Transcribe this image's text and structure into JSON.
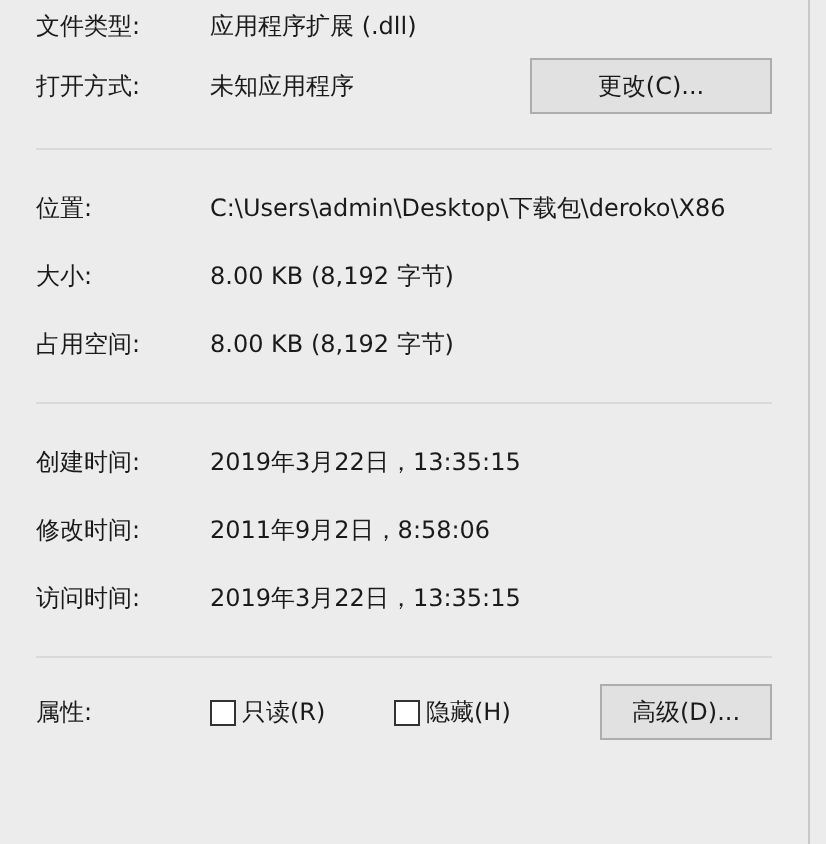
{
  "general": [
    {
      "label": "文件类型:",
      "value": "应用程序扩展 (.dll)"
    },
    {
      "label": "打开方式:",
      "value": "未知应用程序",
      "button": "更改(C)..."
    }
  ],
  "location": [
    {
      "label": "位置:",
      "value": "C:\\Users\\admin\\Desktop\\下载包\\deroko\\X86"
    },
    {
      "label": "大小:",
      "value": "8.00 KB (8,192 字节)"
    },
    {
      "label": "占用空间:",
      "value": "8.00 KB (8,192 字节)"
    }
  ],
  "times": [
    {
      "label": "创建时间:",
      "value": "2019年3月22日，13:35:15"
    },
    {
      "label": "修改时间:",
      "value": "2011年9月2日，8:58:06"
    },
    {
      "label": "访问时间:",
      "value": "2019年3月22日，13:35:15"
    }
  ],
  "attributes": {
    "label": "属性:",
    "checkboxes": [
      {
        "label": "只读(R)",
        "checked": false
      },
      {
        "label": "隐藏(H)",
        "checked": false
      }
    ],
    "button": "高级(D)..."
  }
}
